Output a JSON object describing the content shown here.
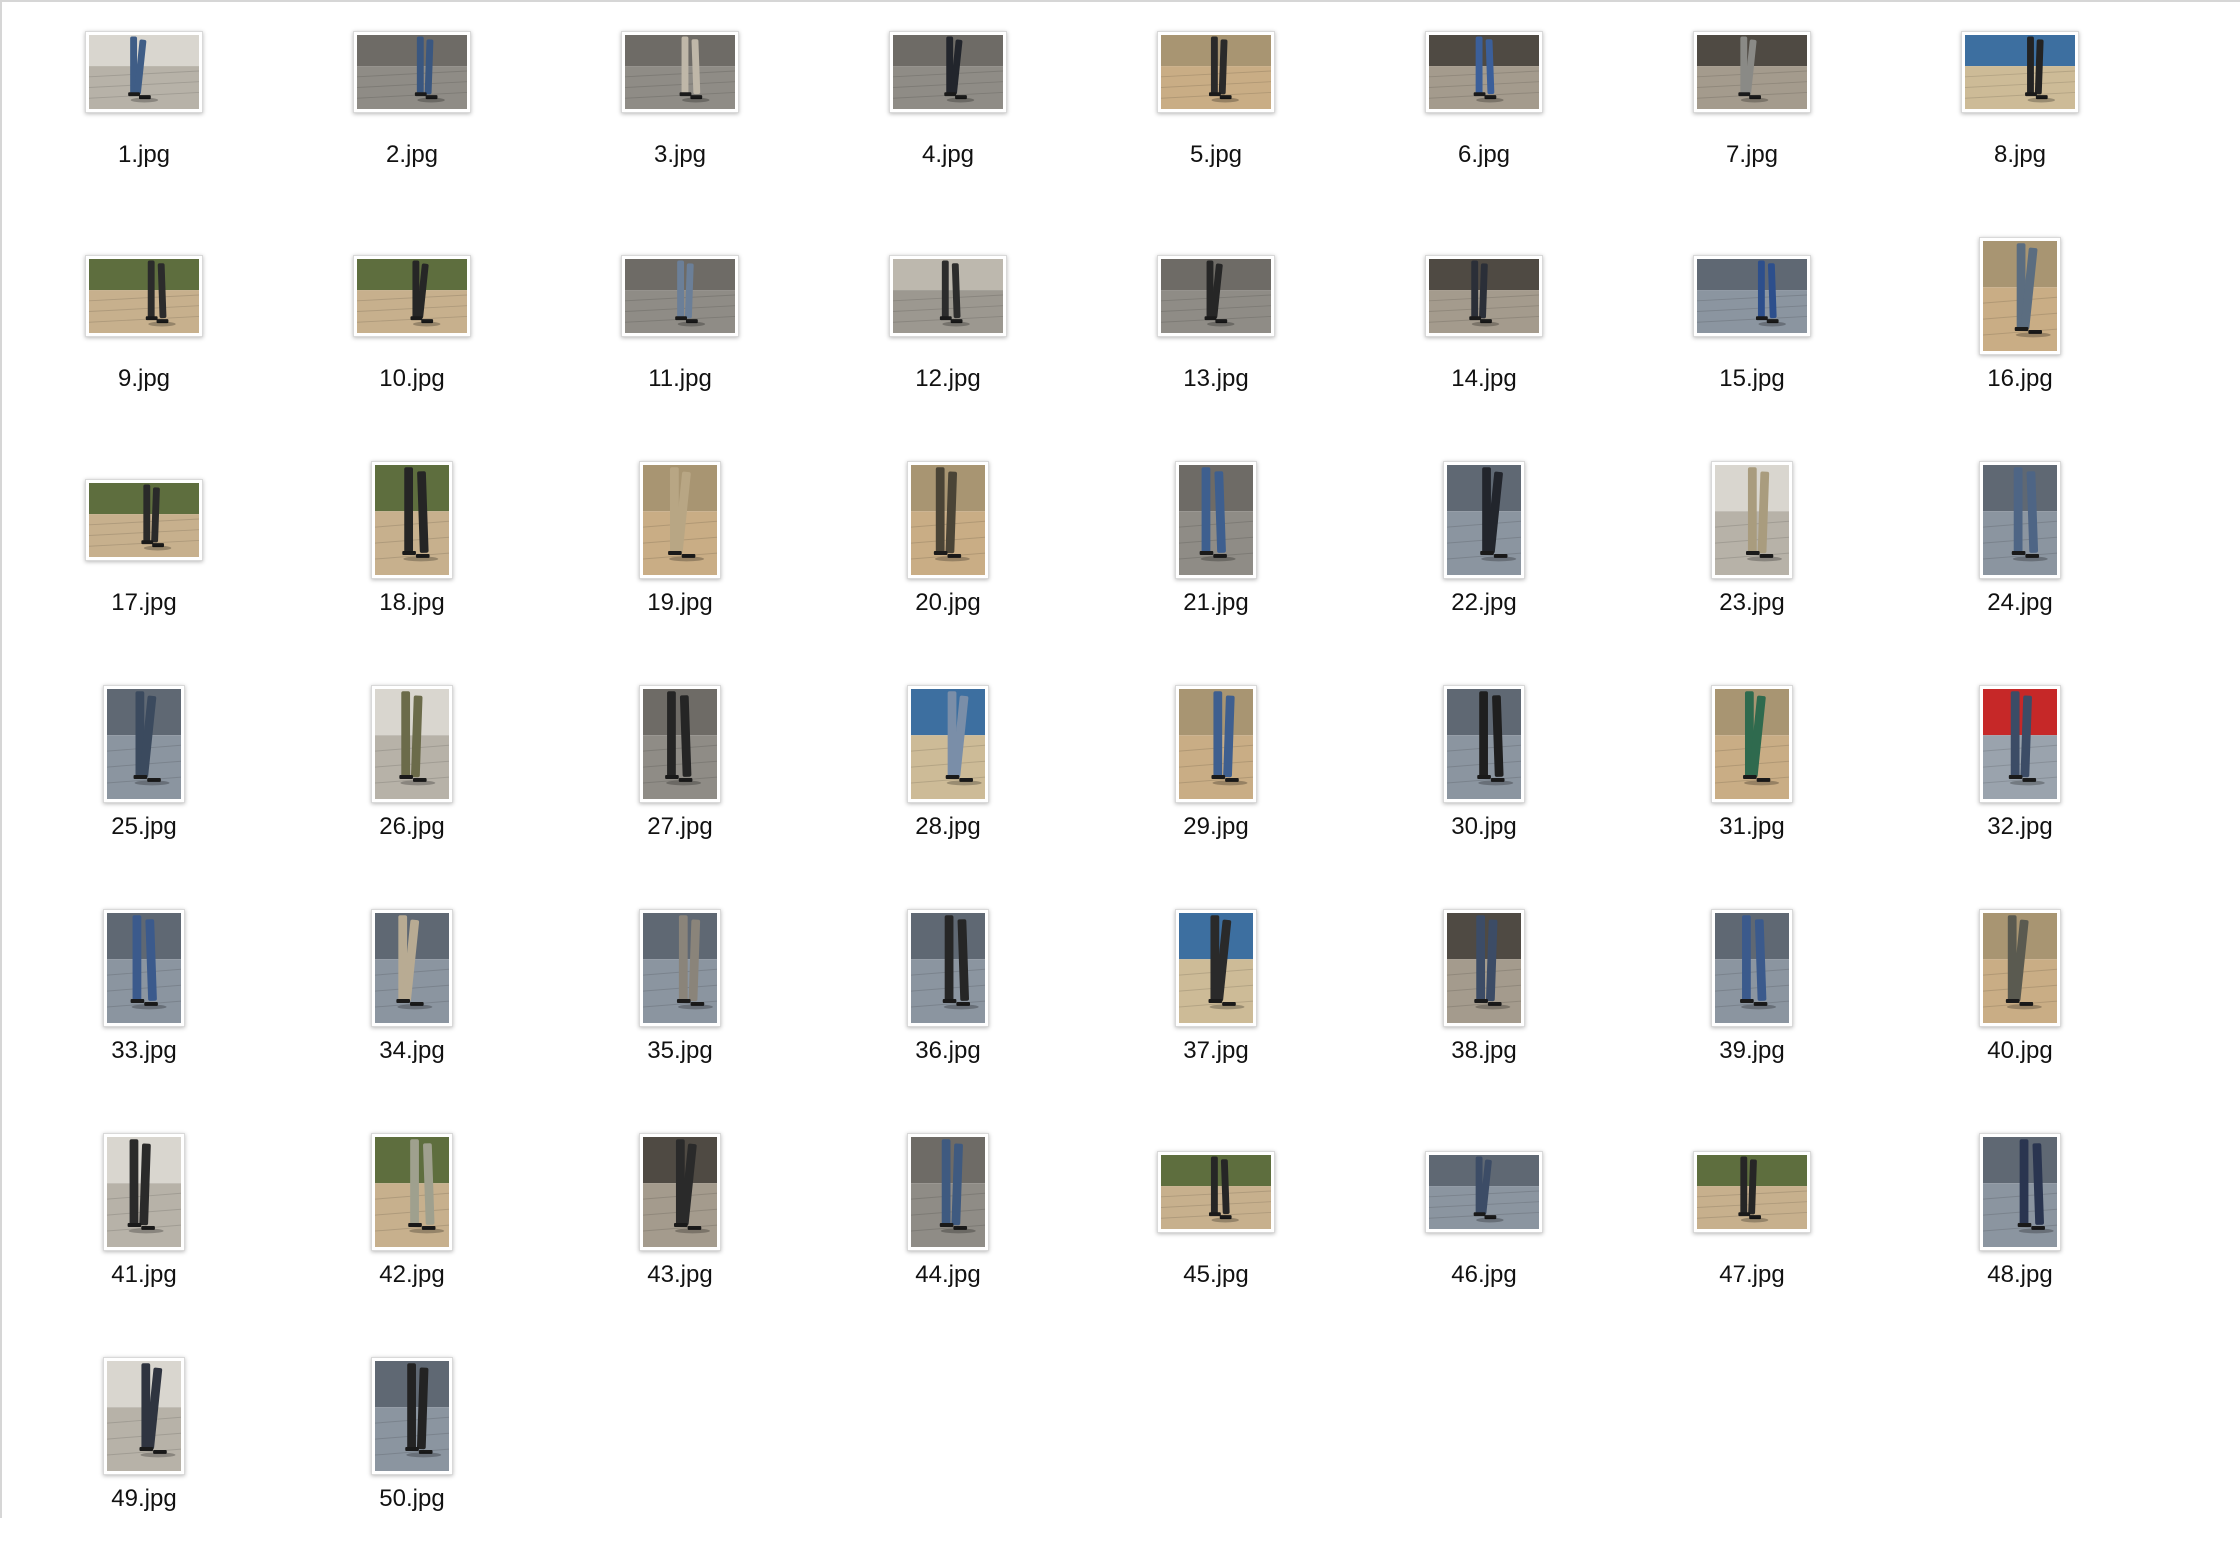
{
  "window": {
    "title": ""
  },
  "files": [
    {
      "name": "1.jpg",
      "orientation": "landscape",
      "scene": "sidewalk",
      "pants": "#3f5d86",
      "dark_pants": false
    },
    {
      "name": "2.jpg",
      "orientation": "landscape",
      "scene": "street",
      "pants": "#3a5780",
      "dark_pants": false
    },
    {
      "name": "3.jpg",
      "orientation": "landscape",
      "scene": "street",
      "pants": "#bfb7a8",
      "dark_pants": false
    },
    {
      "name": "4.jpg",
      "orientation": "landscape",
      "scene": "street",
      "pants": "#22252c",
      "dark_pants": true
    },
    {
      "name": "5.jpg",
      "orientation": "landscape",
      "scene": "sand",
      "pants": "#2a2a2a",
      "dark_pants": true
    },
    {
      "name": "6.jpg",
      "orientation": "landscape",
      "scene": "bench",
      "pants": "#3b5f9a",
      "dark_pants": false
    },
    {
      "name": "7.jpg",
      "orientation": "landscape",
      "scene": "bench",
      "pants": "#8a8a86",
      "dark_pants": false
    },
    {
      "name": "8.jpg",
      "orientation": "landscape",
      "scene": "water",
      "pants": "#232323",
      "dark_pants": true
    },
    {
      "name": "9.jpg",
      "orientation": "landscape",
      "scene": "plants",
      "pants": "#2b2b2b",
      "dark_pants": true
    },
    {
      "name": "10.jpg",
      "orientation": "landscape",
      "scene": "plants",
      "pants": "#262626",
      "dark_pants": true
    },
    {
      "name": "11.jpg",
      "orientation": "landscape",
      "scene": "street",
      "pants": "#6b7f98",
      "dark_pants": false
    },
    {
      "name": "12.jpg",
      "orientation": "landscape",
      "scene": "road",
      "pants": "#2c2c2c",
      "dark_pants": true
    },
    {
      "name": "13.jpg",
      "orientation": "landscape",
      "scene": "street",
      "pants": "#262626",
      "dark_pants": true
    },
    {
      "name": "14.jpg",
      "orientation": "landscape",
      "scene": "bench",
      "pants": "#2b2f38",
      "dark_pants": true
    },
    {
      "name": "15.jpg",
      "orientation": "landscape",
      "scene": "boardwalk",
      "pants": "#2d4f8c",
      "dark_pants": false
    },
    {
      "name": "16.jpg",
      "orientation": "portrait",
      "scene": "sand",
      "pants": "#5b6d80",
      "dark_pants": false
    },
    {
      "name": "17.jpg",
      "orientation": "landscape",
      "scene": "plants",
      "pants": "#2a2a2a",
      "dark_pants": true
    },
    {
      "name": "18.jpg",
      "orientation": "portrait",
      "scene": "plants",
      "pants": "#252525",
      "dark_pants": true
    },
    {
      "name": "19.jpg",
      "orientation": "portrait",
      "scene": "sand",
      "pants": "#b8a684",
      "dark_pants": false
    },
    {
      "name": "20.jpg",
      "orientation": "portrait",
      "scene": "sand",
      "pants": "#4a4436",
      "dark_pants": true
    },
    {
      "name": "21.jpg",
      "orientation": "portrait",
      "scene": "street",
      "pants": "#3e5f8f",
      "dark_pants": false
    },
    {
      "name": "22.jpg",
      "orientation": "portrait",
      "scene": "boardwalk",
      "pants": "#22252c",
      "dark_pants": true
    },
    {
      "name": "23.jpg",
      "orientation": "portrait",
      "scene": "sidewalk",
      "pants": "#a99c7e",
      "dark_pants": false
    },
    {
      "name": "24.jpg",
      "orientation": "portrait",
      "scene": "boardwalk",
      "pants": "#4e6585",
      "dark_pants": false
    },
    {
      "name": "25.jpg",
      "orientation": "portrait",
      "scene": "boardwalk",
      "pants": "#3b4a5e",
      "dark_pants": false
    },
    {
      "name": "26.jpg",
      "orientation": "portrait",
      "scene": "sidewalk",
      "pants": "#6b6b4a",
      "dark_pants": false
    },
    {
      "name": "27.jpg",
      "orientation": "portrait",
      "scene": "street",
      "pants": "#252525",
      "dark_pants": true
    },
    {
      "name": "28.jpg",
      "orientation": "portrait",
      "scene": "water",
      "pants": "#7a8ea8",
      "dark_pants": false
    },
    {
      "name": "29.jpg",
      "orientation": "portrait",
      "scene": "sand",
      "pants": "#3f5f8f",
      "dark_pants": false
    },
    {
      "name": "30.jpg",
      "orientation": "portrait",
      "scene": "boardwalk",
      "pants": "#1f1f1f",
      "dark_pants": true
    },
    {
      "name": "31.jpg",
      "orientation": "portrait",
      "scene": "sand",
      "pants": "#2f6a4e",
      "dark_pants": false
    },
    {
      "name": "32.jpg",
      "orientation": "portrait",
      "scene": "red",
      "pants": "#3c4c66",
      "dark_pants": false
    },
    {
      "name": "33.jpg",
      "orientation": "portrait",
      "scene": "boardwalk",
      "pants": "#3b5a8c",
      "dark_pants": false
    },
    {
      "name": "34.jpg",
      "orientation": "portrait",
      "scene": "boardwalk",
      "pants": "#b8ab93",
      "dark_pants": false
    },
    {
      "name": "35.jpg",
      "orientation": "portrait",
      "scene": "boardwalk",
      "pants": "#8a847a",
      "dark_pants": false
    },
    {
      "name": "36.jpg",
      "orientation": "portrait",
      "scene": "boardwalk",
      "pants": "#262626",
      "dark_pants": true
    },
    {
      "name": "37.jpg",
      "orientation": "portrait",
      "scene": "water",
      "pants": "#2a2a2a",
      "dark_pants": true
    },
    {
      "name": "38.jpg",
      "orientation": "portrait",
      "scene": "bench",
      "pants": "#3c4c66",
      "dark_pants": false
    },
    {
      "name": "39.jpg",
      "orientation": "portrait",
      "scene": "boardwalk",
      "pants": "#3b5a8c",
      "dark_pants": false
    },
    {
      "name": "40.jpg",
      "orientation": "portrait",
      "scene": "sand",
      "pants": "#5a5a50",
      "dark_pants": false
    },
    {
      "name": "41.jpg",
      "orientation": "portrait",
      "scene": "sidewalk",
      "pants": "#2a2a2a",
      "dark_pants": true
    },
    {
      "name": "42.jpg",
      "orientation": "portrait",
      "scene": "plants",
      "pants": "#9fa08e",
      "dark_pants": false
    },
    {
      "name": "43.jpg",
      "orientation": "portrait",
      "scene": "bench",
      "pants": "#2a2a2a",
      "dark_pants": true
    },
    {
      "name": "44.jpg",
      "orientation": "portrait",
      "scene": "street",
      "pants": "#3f5a80",
      "dark_pants": false
    },
    {
      "name": "45.jpg",
      "orientation": "landscape",
      "scene": "plants",
      "pants": "#262626",
      "dark_pants": true
    },
    {
      "name": "46.jpg",
      "orientation": "landscape",
      "scene": "boardwalk",
      "pants": "#3c4c66",
      "dark_pants": false
    },
    {
      "name": "47.jpg",
      "orientation": "landscape",
      "scene": "plants",
      "pants": "#262626",
      "dark_pants": true
    },
    {
      "name": "48.jpg",
      "orientation": "portrait",
      "scene": "boardwalk",
      "pants": "#2a3550",
      "dark_pants": true
    },
    {
      "name": "49.jpg",
      "orientation": "portrait",
      "scene": "sidewalk",
      "pants": "#2f3440",
      "dark_pants": true
    },
    {
      "name": "50.jpg",
      "orientation": "portrait",
      "scene": "boardwalk",
      "pants": "#232323",
      "dark_pants": true
    }
  ],
  "scene_palette": {
    "sidewalk": {
      "ground": "#b7b2a8",
      "back": "#d9d6cf"
    },
    "street": {
      "ground": "#8f8c86",
      "back": "#6e6b66"
    },
    "road": {
      "ground": "#9c9890",
      "back": "#bdb8ae"
    },
    "sand": {
      "ground": "#c9ad85",
      "back": "#a89572"
    },
    "bench": {
      "ground": "#a49b8d",
      "back": "#4f4a43"
    },
    "water": {
      "ground": "#cdbb97",
      "back": "#3d6fa0"
    },
    "plants": {
      "ground": "#c7b08d",
      "back": "#5e6e3e"
    },
    "boardwalk": {
      "ground": "#8b95a0",
      "back": "#5f6873"
    },
    "red": {
      "ground": "#9aa3ad",
      "back": "#c62828"
    }
  }
}
